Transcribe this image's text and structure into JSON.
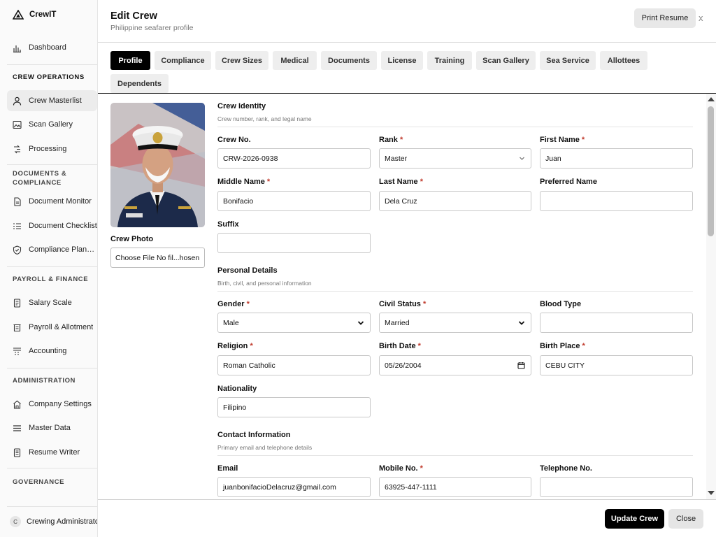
{
  "sidebar": {
    "brand": "CrewIT",
    "dashboard": "Dashboard",
    "sections": {
      "crew_operations": "CREW OPERATIONS",
      "documents": "DOCUMENTS & COMPLIANCE",
      "payroll": "PAYROLL & FINANCE",
      "administration": "ADMINISTRATION",
      "governance": "GOVERNANCE"
    },
    "items": {
      "crew_masterlist": "Crew Masterlist",
      "scan_gallery": "Scan Gallery",
      "processing": "Processing",
      "document_monitor": "Document Monitor",
      "document_checklist": "Document Checklist",
      "compliance_planning": "Compliance Planni...",
      "salary_scale": "Salary Scale",
      "payroll_allotment": "Payroll & Allotment",
      "accounting": "Accounting",
      "company_settings": "Company Settings",
      "master_data": "Master Data",
      "resume_writer": "Resume Writer"
    },
    "user": {
      "initial": "C",
      "name": "Crewing Administrator"
    }
  },
  "modal": {
    "title": "Edit Crew",
    "subtitle": "Philippine seafarer profile",
    "print_resume": "Print Resume",
    "close_x": "x",
    "tabs": [
      "Profile",
      "Compliance",
      "Crew Sizes",
      "Medical",
      "Documents",
      "License",
      "Training",
      "Scan Gallery",
      "Sea Service",
      "Allottees",
      "Dependents"
    ],
    "active_tab": "Profile",
    "photo_label": "Crew Photo",
    "file_input": "Choose File No fil...hosen",
    "required_mark": "*",
    "sections": {
      "identity": {
        "title": "Crew Identity",
        "desc": "Crew number, rank, and legal name"
      },
      "personal": {
        "title": "Personal Details",
        "desc": "Birth, civil, and personal information"
      },
      "contact": {
        "title": "Contact Information",
        "desc": "Primary email and telephone details"
      }
    },
    "fields": {
      "crew_no": {
        "label": "Crew No.",
        "value": "CRW-2026-0938"
      },
      "rank": {
        "label": "Rank",
        "value": "Master"
      },
      "first_name": {
        "label": "First Name",
        "value": "Juan"
      },
      "middle_name": {
        "label": "Middle Name",
        "value": "Bonifacio"
      },
      "last_name": {
        "label": "Last Name",
        "value": "Dela Cruz"
      },
      "preferred_name": {
        "label": "Preferred Name",
        "value": ""
      },
      "suffix": {
        "label": "Suffix",
        "value": ""
      },
      "gender": {
        "label": "Gender",
        "value": "Male"
      },
      "civil_status": {
        "label": "Civil Status",
        "value": "Married"
      },
      "blood_type": {
        "label": "Blood Type",
        "value": ""
      },
      "religion": {
        "label": "Religion",
        "value": "Roman Catholic"
      },
      "birth_date": {
        "label": "Birth Date",
        "value": "05/26/2004"
      },
      "birth_place": {
        "label": "Birth Place",
        "value": "CEBU CITY"
      },
      "nationality": {
        "label": "Nationality",
        "value": "Filipino"
      },
      "email": {
        "label": "Email",
        "value": "juanbonifacioDelacruz@gmail.com"
      },
      "mobile": {
        "label": "Mobile No.",
        "value": "63925-447-1111"
      },
      "telephone": {
        "label": "Telephone No.",
        "value": ""
      }
    },
    "footer": {
      "update": "Update Crew",
      "close": "Close"
    }
  },
  "colors": {
    "accent": "#000000",
    "required": "#c0392b",
    "active_nav": "#ececec"
  }
}
